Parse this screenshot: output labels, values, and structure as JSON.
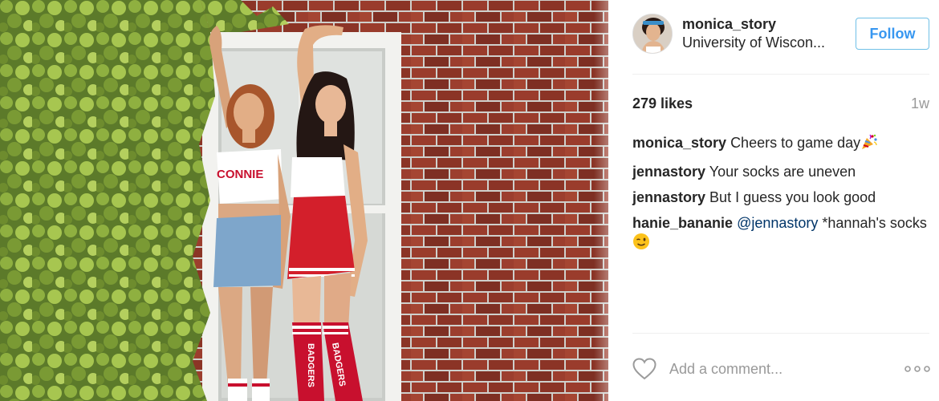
{
  "post": {
    "username": "monica_story",
    "location": "University of Wiscon...",
    "follow_label": "Follow",
    "likes": "279 likes",
    "time_ago": "1w"
  },
  "comments": [
    {
      "author": "monica_story",
      "text": "Cheers to game day",
      "emoji": "party-popper-emoji"
    },
    {
      "author": "jennastory",
      "text": "Your socks are uneven"
    },
    {
      "author": "jennastory",
      "text": "But I guess you look good"
    },
    {
      "author": "hanie_bananie",
      "mention": "@jennastory",
      "text": "*hannah's socks",
      "emoji": "winking-face-emoji"
    }
  ],
  "composer": {
    "placeholder": "Add a comment..."
  },
  "photo": {
    "left_shirt_text": "CONNIE",
    "left_sock_text": "BADGERS",
    "right_sock_text": "BADGERS"
  },
  "icons": {
    "heart": "heart-outline-icon",
    "more": "more-options-icon"
  },
  "colors": {
    "follow_blue": "#3897f0",
    "follow_border": "#70c0e7",
    "mention_blue": "#003569",
    "muted_gray": "#999999",
    "badger_red": "#c8102e"
  }
}
